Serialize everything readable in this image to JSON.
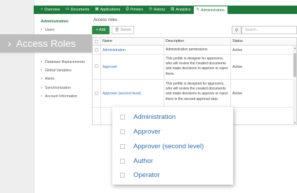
{
  "topnav": {
    "items": [
      {
        "label": "Overview",
        "icon": "home-icon"
      },
      {
        "label": "Documents",
        "icon": "folder-icon"
      },
      {
        "label": "Applications",
        "icon": "apps-icon"
      },
      {
        "label": "Printers",
        "icon": "printer-icon"
      },
      {
        "label": "History",
        "icon": "history-icon"
      },
      {
        "label": "Analytics",
        "icon": "chart-icon"
      },
      {
        "label": "Administration",
        "icon": "admin-icon"
      }
    ],
    "active": "Administration"
  },
  "sidebar": {
    "heading": "Administration",
    "items": [
      "Users",
      "Database Replacements",
      "Global Variables",
      "Alerts",
      "Synchronization",
      "Account Information"
    ]
  },
  "callout": {
    "label": "Access Roles"
  },
  "main": {
    "title": "Access roles",
    "add_label": "Add",
    "delete_label": "Delete",
    "search_placeholder": "Search..."
  },
  "table": {
    "headers": {
      "name": "Name",
      "description": "Description",
      "status": "Status"
    },
    "rows": [
      {
        "name": "Administration",
        "description": "Administrative permissions",
        "status": "Active"
      },
      {
        "name": "Approver",
        "description": "This profile is designer for approvers, who will review the created documents and make decisions to approve or reject them.",
        "status": "Active"
      },
      {
        "name": "Approver (second level)",
        "description": "This profile is designed for approvers, who will review the created documents and make decisions to approve or reject them in the second approval step.",
        "status": "Active"
      }
    ]
  },
  "popup": {
    "items": [
      "Administration",
      "Approver",
      "Approver (second level)",
      "Author",
      "Operator"
    ]
  },
  "colors": {
    "nav_green": "#1e7a3a",
    "add_green": "#2e8b47",
    "link_blue": "#2f6fb3",
    "callout_gray": "#bdbdbd"
  }
}
